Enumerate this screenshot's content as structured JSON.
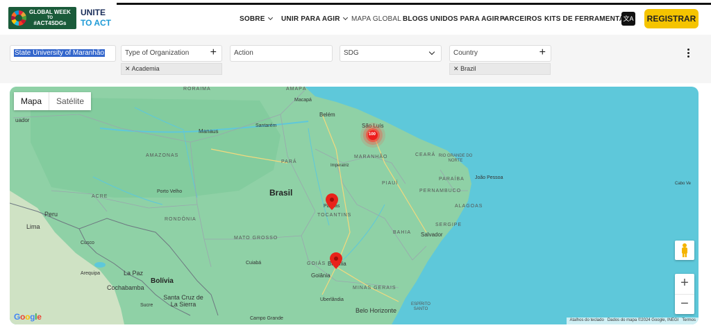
{
  "header": {
    "logo_line1": "GLOBAL WEEK",
    "logo_line2": "TO",
    "logo_line3": "#ACT4SDGs",
    "brand_line1": "UNITE",
    "brand_line2": "TO ACT",
    "nav": [
      {
        "label": "SOBRE",
        "dropdown": true
      },
      {
        "label": "UNIR PARA AGIR",
        "dropdown": true
      },
      {
        "label": "MAPA GLOBAL",
        "dropdown": false
      },
      {
        "label": "BLOGS UNIDOS PARA AGIR",
        "dropdown": true
      },
      {
        "label": "PARCEIROS",
        "dropdown": false
      },
      {
        "label": "KITS DE FERRAMENTAS",
        "dropdown": false
      }
    ],
    "register_label": "REGISTRAR"
  },
  "filters": {
    "search_value": "State University of Maranhão",
    "org_type_placeholder": "Type of Organization",
    "org_type_chip": "Academia",
    "action_placeholder": "Action",
    "sdg_placeholder": "SDG",
    "country_placeholder": "Country",
    "country_chip": "Brazil"
  },
  "map": {
    "type_map": "Mapa",
    "type_satellite": "Satélite",
    "cluster_count": "100",
    "attribution": {
      "shortcuts": "Atalhos do teclado",
      "data": "Dados do mapa ©2024 Google, INEGI",
      "terms": "Termos"
    },
    "google_letters": [
      "G",
      "o",
      "o",
      "g",
      "l",
      "e"
    ],
    "labels": {
      "roraima": "RORAIMA",
      "amapa": "AMAPÁ",
      "macapa": "Macapá",
      "belem": "Belém",
      "sao_luis": "São Luís",
      "manaus": "Manaus",
      "santarem": "Santarém",
      "amazonas": "AMAZONAS",
      "para": "PARÁ",
      "imperatriz": "Imperatriz",
      "maranhao": "MARANHÃO",
      "ceara": "CEARÁ",
      "rio_grande_do_norte": "RIO GRANDE DO NORTE",
      "paraiba": "PARAÍBA",
      "joao_pessoa": "João Pessoa",
      "pernambuco": "PERNAMBUCO",
      "piaui": "PIAUÍ",
      "alagoas": "ALAGOAS",
      "sergipe": "SERGIPE",
      "bahia": "BAHIA",
      "salvador": "Salvador",
      "brasil": "Brasil",
      "acre": "ACRE",
      "porto_velho": "Porto Velho",
      "rondonia": "RONDÔNIA",
      "tocantins": "TOCANTINS",
      "palmas": "Palmas",
      "mato_grosso": "MATO GROSSO",
      "cuiaba": "Cuiabá",
      "goias": "GOIÁS",
      "brasilia": "Brasília",
      "goiania": "Goiânia",
      "minas_gerais": "MINAS GERAIS",
      "uberlandia": "Uberlândia",
      "belo_horizonte": "Belo Horizonte",
      "espirito_santo": "ESPÍRITO SANTO",
      "campo_grande": "Campo Grande",
      "peru": "Peru",
      "lima": "Lima",
      "cusco": "Cusco",
      "arequipa": "Arequipa",
      "la_paz": "La Paz",
      "bolivia": "Bolívia",
      "cochabamba": "Cochabamba",
      "santa_cruz": "Santa Cruz de La Sierra",
      "sucre": "Sucre",
      "equador": "uador",
      "cabo": "Cabo Ve"
    }
  }
}
